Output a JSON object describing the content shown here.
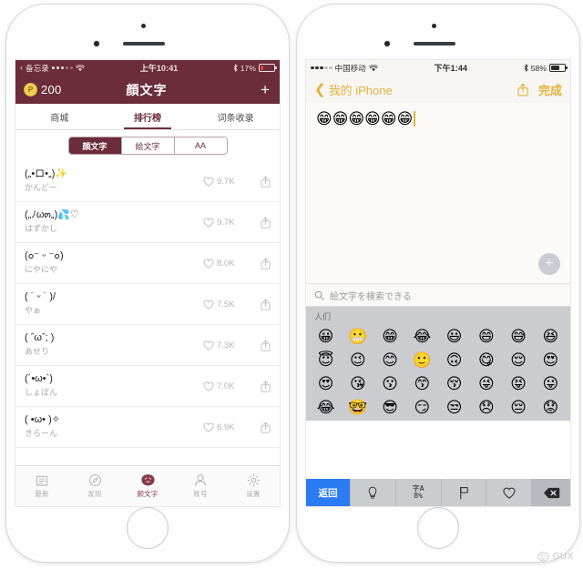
{
  "left_phone": {
    "status_bar": {
      "back_glyph": "‹",
      "back_app": "备忘录",
      "signal_on": 3,
      "signal_off": 2,
      "wifi_icon": "wifi-icon",
      "time": "上午10:41",
      "bluetooth_icon": "bluetooth-icon",
      "battery_percent": "17%",
      "battery_level": 17
    },
    "header": {
      "coin_icon_letter": "P",
      "coin_value": "200",
      "title": "顔文字",
      "add_label": "+"
    },
    "tabs": [
      {
        "label": "商城",
        "active": false
      },
      {
        "label": "排行榜",
        "active": true
      },
      {
        "label": "词条收录",
        "active": false
      }
    ],
    "segmented": [
      {
        "label": "顔文字",
        "active": true
      },
      {
        "label": "絵文字",
        "active": false
      },
      {
        "label": "AA",
        "active": false
      }
    ],
    "rows": [
      {
        "kaomoji": "(„•̀ロ•́„)✨",
        "reading": "かんどー",
        "likes": "9.7K"
      },
      {
        "kaomoji": "(„ﾉω๓„)💦♡",
        "reading": "はずかし",
        "likes": "9.7K"
      },
      {
        "kaomoji": "(๐⁻ ᵕ ⁻๐)",
        "reading": "にやにや",
        "likes": "8.0K"
      },
      {
        "kaomoji": "( ˙ ᵕ ˙ )/",
        "reading": "やぁ",
        "likes": "7.5K"
      },
      {
        "kaomoji": "( ˆωˆ; )",
        "reading": "あせり",
        "likes": "7.3K"
      },
      {
        "kaomoji": "(´•ω•`)",
        "reading": "しょぼん",
        "likes": "7.0K"
      },
      {
        "kaomoji": "( •ω• )✧",
        "reading": "きらーん",
        "likes": "6.9K"
      }
    ],
    "tabbar": [
      {
        "label": "最新",
        "icon": "newspaper-icon",
        "active": false
      },
      {
        "label": "发现",
        "icon": "compass-icon",
        "active": false
      },
      {
        "label": "颜文字",
        "icon": "face-icon",
        "active": true
      },
      {
        "label": "账号",
        "icon": "person-icon",
        "active": false
      },
      {
        "label": "设置",
        "icon": "gear-icon",
        "active": false
      }
    ],
    "accent_color": "#6b2c3b"
  },
  "right_phone": {
    "status_bar": {
      "carrier": "中国移动",
      "signal_on": 3,
      "signal_off": 2,
      "wifi_icon": "wifi-icon",
      "time": "下午1:44",
      "bluetooth_icon": "bluetooth-icon",
      "battery_percent": "58%",
      "battery_level": 58
    },
    "nav": {
      "back_glyph": "❮",
      "back_label": "我的 iPhone",
      "share_icon": "share-icon",
      "done_label": "完成"
    },
    "note": {
      "content": "😁😁😁😁😁😁",
      "fab_label": "+"
    },
    "keyboard": {
      "search_placeholder": "絵文字を検索できる",
      "search_icon": "search-icon",
      "category": "人们",
      "emoji_rows": [
        [
          "😀",
          "😬",
          "😁",
          "😂",
          "😃",
          "😄",
          "😅",
          "😆"
        ],
        [
          "😇",
          "😉",
          "😊",
          "🙂",
          "🙃",
          "😋",
          "😌",
          "😍"
        ],
        [
          "😍",
          "😘",
          "😗",
          "😙",
          "😚",
          "😜",
          "😝",
          "😛"
        ],
        [
          "😂",
          "🤓",
          "😎",
          "😏",
          "😒",
          "😞",
          "😔",
          "😟"
        ]
      ],
      "bottom_keys": [
        {
          "label": "返回",
          "icon": "",
          "name": "return-key",
          "style": "blue"
        },
        {
          "label": "",
          "icon": "bulb-icon",
          "name": "recent-key",
          "style": "plain"
        },
        {
          "label": "",
          "icon": "symbols-icon",
          "name": "symbols-key",
          "style": "plain"
        },
        {
          "label": "",
          "icon": "flag-icon",
          "name": "flags-key",
          "style": "plain"
        },
        {
          "label": "",
          "icon": "heart-icon",
          "name": "hearts-key",
          "style": "plain"
        },
        {
          "label": "",
          "icon": "delete-icon",
          "name": "delete-key",
          "style": "grey"
        }
      ]
    },
    "accent_color": "#e2b13c"
  },
  "watermark": {
    "text": "GUX",
    "icon": "face-icon"
  }
}
